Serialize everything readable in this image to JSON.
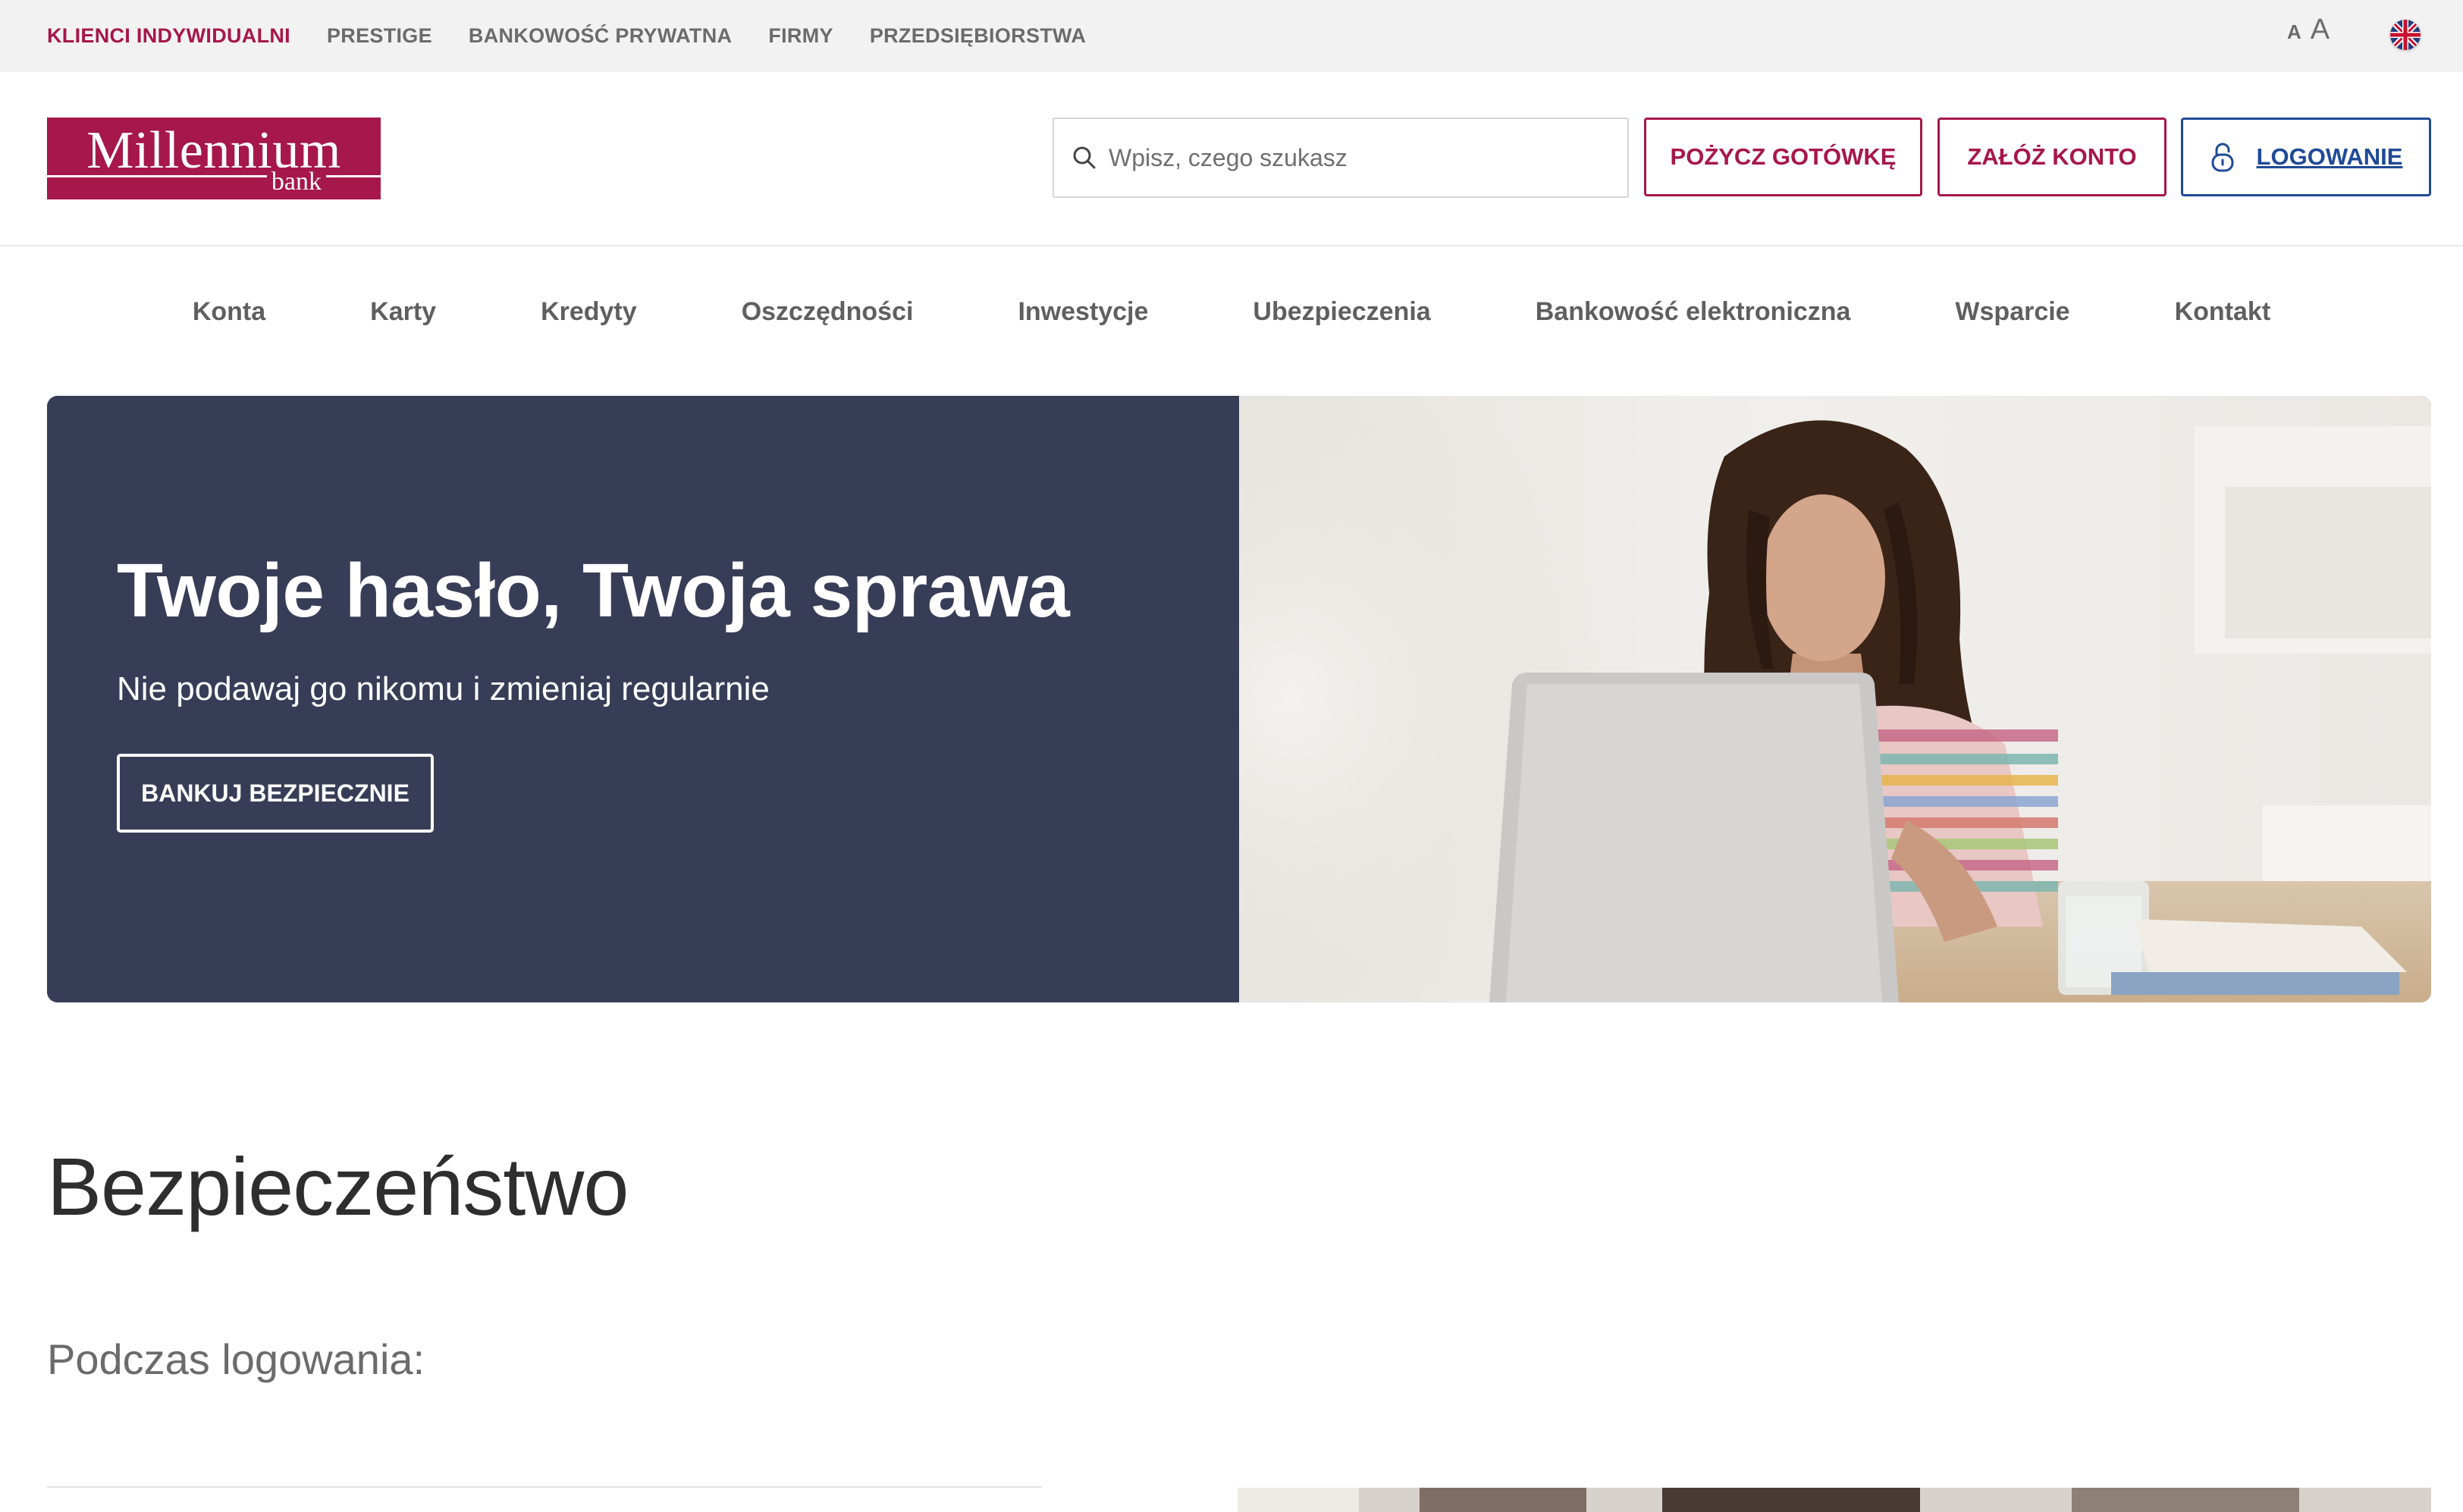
{
  "topbar": {
    "segments": [
      "KLIENCI INDYWIDUALNI",
      "PRESTIGE",
      "BANKOWOŚĆ PRYWATNA",
      "FIRMY",
      "PRZEDSIĘBIORSTWA"
    ],
    "active_segment": "KLIENCI INDYWIDUALNI",
    "font_small": "A",
    "font_large": "A",
    "language_icon": "uk-flag-icon"
  },
  "header": {
    "logo_text": "Millennium",
    "logo_subtext": "bank",
    "search_placeholder": "Wpisz, czego szukasz",
    "search_value": "",
    "loan_button": "POŻYCZ GOTÓWKĘ",
    "account_button": "ZAŁÓŻ KONTO",
    "login_button": "LOGOWANIE",
    "login_icon": "lock-icon"
  },
  "nav": {
    "items": [
      "Konta",
      "Karty",
      "Kredyty",
      "Oszczędności",
      "Inwestycje",
      "Ubezpieczenia",
      "Bankowość elektroniczna",
      "Wsparcie",
      "Kontakt"
    ]
  },
  "hero": {
    "title": "Twoje hasło, Twoja sprawa",
    "subtitle": "Nie podawaj go nikomu i zmieniaj regularnie",
    "cta": "BANKUJ BEZPIECZNIE"
  },
  "content": {
    "title": "Bezpieczeństwo",
    "subtitle": "Podczas logowania:"
  },
  "colors": {
    "brand": "#a6174a",
    "login_blue": "#1f4a96",
    "hero_bg": "#383d57",
    "topbar_bg": "#f2f2f2"
  }
}
